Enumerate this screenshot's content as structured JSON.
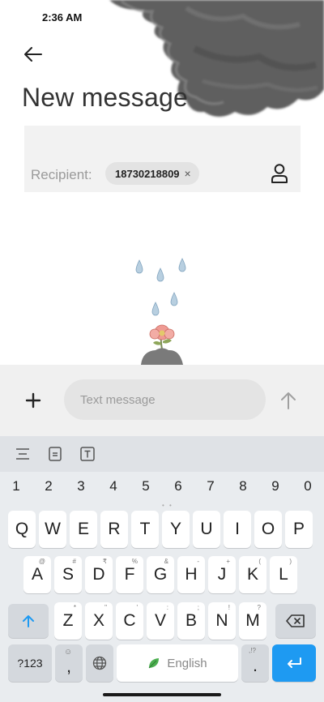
{
  "status_bar": {
    "time": "2:36 AM",
    "icons": [
      "signal-icon",
      "wifi-icon",
      "battery-icon"
    ]
  },
  "header": {
    "back_icon": "arrow-left-icon",
    "title": "New message"
  },
  "recipient": {
    "label": "Recipient:",
    "chip_value": "18730218809",
    "chip_remove": "×",
    "contact_icon": "person-icon"
  },
  "compose": {
    "add_icon": "plus-icon",
    "placeholder": "Text message",
    "send_icon": "arrow-up-icon"
  },
  "keyboard": {
    "toolbar_icons": [
      "text-align-icon",
      "clipboard-icon",
      "text-box-icon"
    ],
    "number_row": [
      "1",
      "2",
      "3",
      "4",
      "5",
      "6",
      "7",
      "8",
      "9",
      "0"
    ],
    "row1": [
      "Q",
      "W",
      "E",
      "R",
      "T",
      "Y",
      "U",
      "I",
      "O",
      "P"
    ],
    "row2": [
      "A",
      "S",
      "D",
      "F",
      "G",
      "H",
      "J",
      "K",
      "L"
    ],
    "row2_sub": [
      "@",
      "#",
      "₹",
      "%",
      "&",
      "-",
      "+",
      "(",
      ")"
    ],
    "row3": [
      "Z",
      "X",
      "C",
      "V",
      "B",
      "N",
      "M"
    ],
    "row3_sub": [
      "*",
      "\"",
      "'",
      ":",
      ";",
      "!",
      "?"
    ],
    "symbols_label": "?123",
    "comma_label": ",",
    "comma_sub": "☺",
    "space_label": "English",
    "period_label": ".",
    "period_sub": ",!?",
    "shift_icon": "shift-arrow-icon",
    "backspace_icon": "backspace-icon",
    "globe_icon": "globe-icon",
    "enter_icon": "enter-icon"
  },
  "colors": {
    "accent": "#1e9af2",
    "compose_bg": "#f0f0f0",
    "keyboard_bg": "#e9ecef"
  }
}
